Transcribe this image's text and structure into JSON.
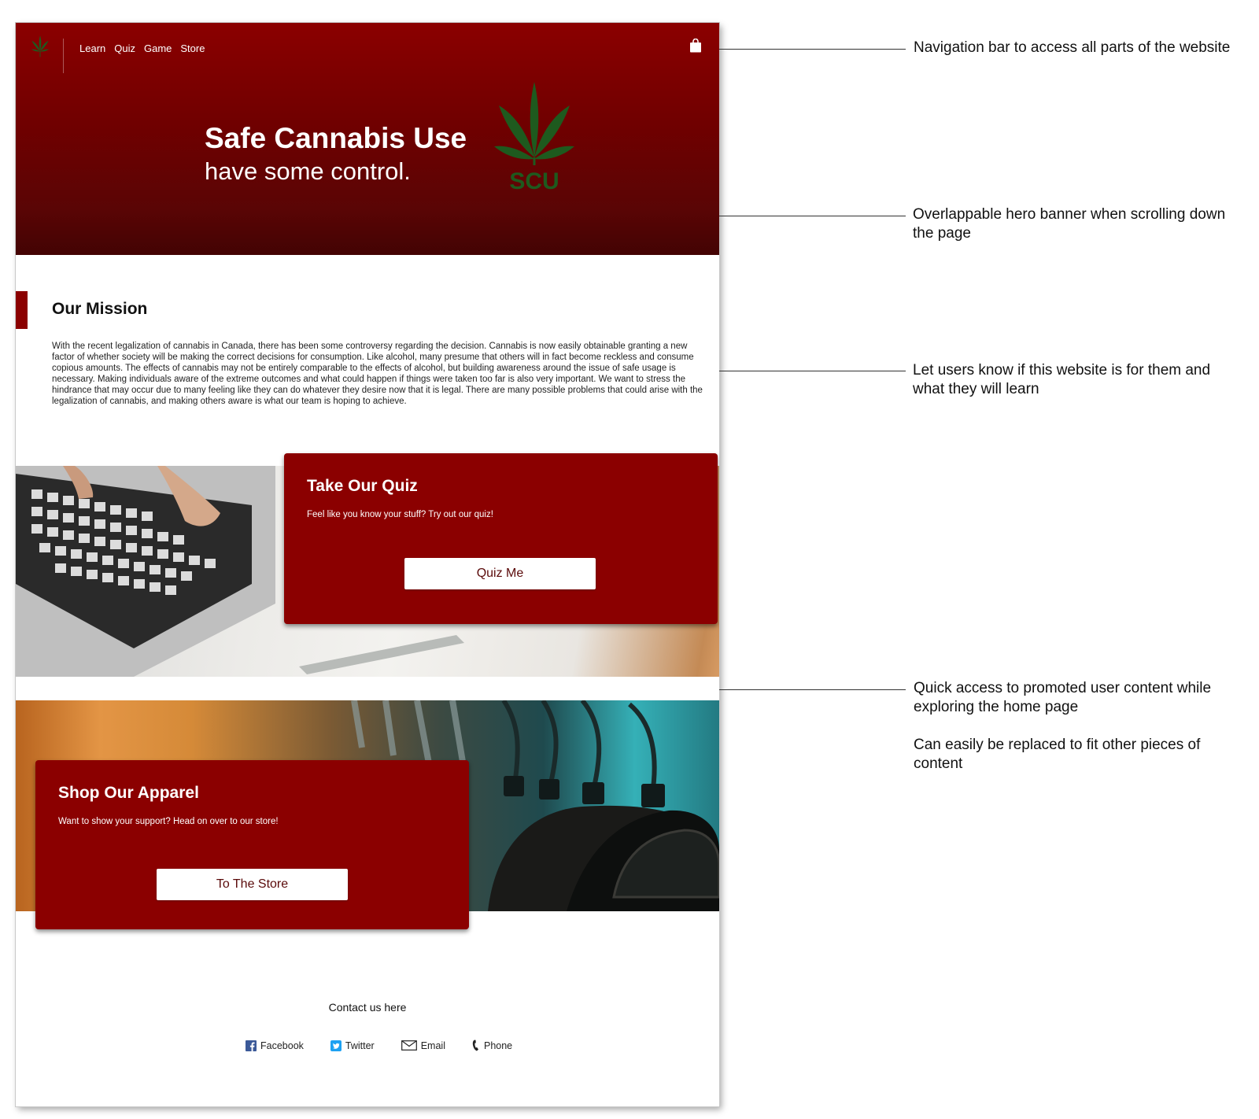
{
  "nav": {
    "links": [
      "Learn",
      "Quiz",
      "Game",
      "Store"
    ]
  },
  "hero": {
    "title": "Safe Cannabis Use",
    "subtitle": "have some control.",
    "logo_text": "SCU"
  },
  "mission": {
    "title": "Our Mission",
    "text": "With the recent legalization of cannabis in Canada, there has been some controversy regarding the decision. Cannabis is now easily obtainable granting a new factor of whether society will be making the correct decisions for consumption. Like alcohol, many presume that others will in fact become reckless and consume copious amounts. The effects of cannabis may not be entirely comparable to the effects of alcohol, but building awareness around the issue of safe usage is necessary. Making individuals aware of the extreme outcomes and what could happen if things were taken too far is also very important. We want to stress the hindrance that may occur due to many feeling like they can do whatever they desire now that it is legal. There are many possible problems that could arise with the legalization of cannabis, and making others aware is what our team is hoping to achieve."
  },
  "quiz_card": {
    "title": "Take Our Quiz",
    "text": "Feel like you know your stuff? Try out our quiz!",
    "button": "Quiz Me"
  },
  "apparel_card": {
    "title": "Shop Our Apparel",
    "text": "Want to show your support? Head on over to our store!",
    "button": "To The Store"
  },
  "contact": {
    "title": "Contact us here",
    "links": [
      "Facebook",
      "Twitter",
      "Email",
      "Phone"
    ]
  },
  "annotations": [
    "Navigation bar to access all parts of the website",
    "Overlappable hero banner when scrolling down the page",
    "Let users know if this website is for them and what they will learn",
    "Quick access to promoted user content while exploring the home page",
    "Can easily be replaced to fit other pieces of content"
  ],
  "colors": {
    "brand_red": "#8b0000",
    "leaf_green": "#1e5a1e",
    "facebook_blue": "#3b5998",
    "twitter_blue": "#1da1f2"
  },
  "icons": [
    "cannabis-leaf-icon",
    "shopping-bag-icon",
    "facebook-icon",
    "twitter-icon",
    "email-icon",
    "phone-icon"
  ]
}
